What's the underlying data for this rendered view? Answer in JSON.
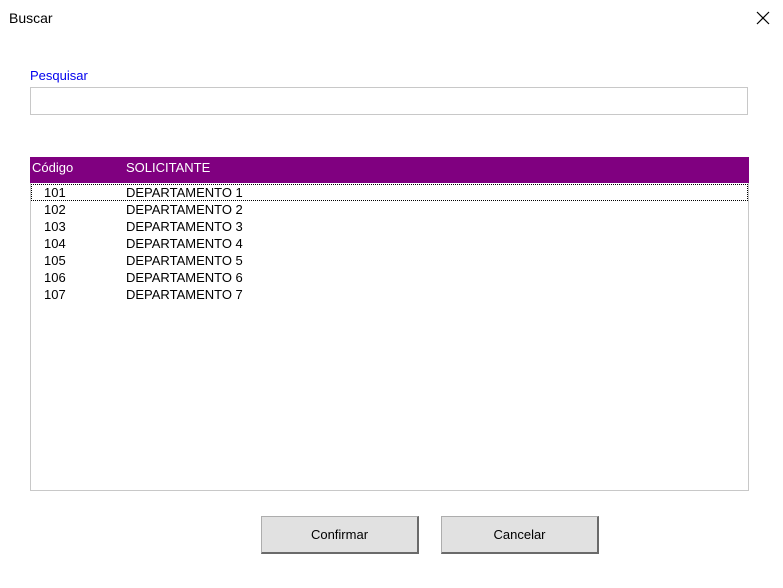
{
  "window": {
    "title": "Buscar",
    "close_icon": "close-icon"
  },
  "search": {
    "label": "Pesquisar",
    "value": "",
    "placeholder": ""
  },
  "list": {
    "header_bg": "#800080",
    "columns": [
      "Código",
      "SOLICITANTE"
    ],
    "rows": [
      {
        "code": "101",
        "requester": "DEPARTAMENTO 1"
      },
      {
        "code": "102",
        "requester": "DEPARTAMENTO 2"
      },
      {
        "code": "103",
        "requester": "DEPARTAMENTO 3"
      },
      {
        "code": "104",
        "requester": "DEPARTAMENTO 4"
      },
      {
        "code": "105",
        "requester": "DEPARTAMENTO 5"
      },
      {
        "code": "106",
        "requester": "DEPARTAMENTO 6"
      },
      {
        "code": "107",
        "requester": "DEPARTAMENTO 7"
      }
    ]
  },
  "buttons": {
    "confirm": "Confirmar",
    "cancel": "Cancelar"
  }
}
